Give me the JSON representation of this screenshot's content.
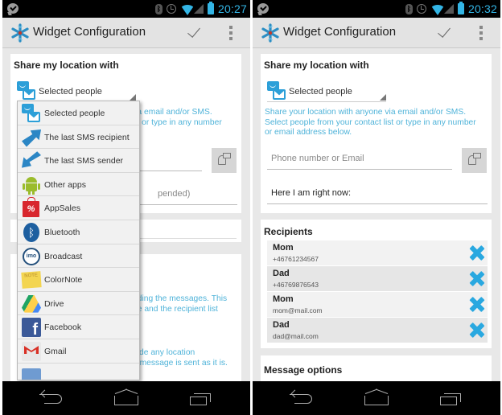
{
  "colors": {
    "accent": "#33b5e5",
    "help_text": "#4fb3d9",
    "remove_icon": "#29a8e0",
    "actionbar_bg": "#e3e3e3",
    "page_bg": "#e8e8e8"
  },
  "screens": [
    {
      "status_bar": {
        "notification_icon": "chat-bubble-check-icon",
        "icons": [
          "bluetooth-icon",
          "alarm-icon",
          "wifi-icon",
          "signal-icon",
          "battery-icon"
        ],
        "time": "20:27"
      },
      "action_bar": {
        "app_icon": "snowflake-app-icon",
        "title": "Widget Configuration",
        "confirm_icon": "check-icon",
        "overflow_icon": "overflow-menu-icon"
      },
      "share_card": {
        "title": "Share my location with",
        "spinner_value": "Selected people",
        "partial_help_text": [
          "via email and/or SMS.",
          "ist or type in any number"
        ],
        "partial_message_hint": "pended)"
      },
      "partial_card_2_text": [
        "nding the messages. This",
        "ge and the recipient list"
      ],
      "partial_card_3_text": [
        "lude any location",
        "e message is sent as it is."
      ],
      "dropdown": {
        "items": [
          {
            "label": "Selected people",
            "icon": "selected-people-icon"
          },
          {
            "label": "The last SMS recipient",
            "icon": "arrow-out-icon"
          },
          {
            "label": "The last SMS sender",
            "icon": "arrow-in-icon"
          },
          {
            "label": "Other apps",
            "icon": "android-icon"
          },
          {
            "label": "AppSales",
            "icon": "appsales-icon"
          },
          {
            "label": "Bluetooth",
            "icon": "bluetooth-icon"
          },
          {
            "label": "Broadcast",
            "icon": "imo-icon"
          },
          {
            "label": "ColorNote",
            "icon": "colornote-icon"
          },
          {
            "label": "Drive",
            "icon": "drive-icon"
          },
          {
            "label": "Facebook",
            "icon": "facebook-icon"
          },
          {
            "label": "Gmail",
            "icon": "gmail-icon"
          }
        ]
      },
      "nav_bar": {
        "back": "back-icon",
        "home": "home-icon",
        "recents": "recents-icon"
      }
    },
    {
      "status_bar": {
        "notification_icon": "chat-bubble-check-icon",
        "icons": [
          "bluetooth-icon",
          "alarm-icon",
          "wifi-icon",
          "signal-icon",
          "battery-icon"
        ],
        "time": "20:32"
      },
      "action_bar": {
        "app_icon": "snowflake-app-icon",
        "title": "Widget Configuration",
        "confirm_icon": "check-icon",
        "overflow_icon": "overflow-menu-icon"
      },
      "share_card": {
        "title": "Share my location with",
        "spinner_value": "Selected people",
        "help_text": [
          "Share your location with anyone via email and/or SMS.",
          "Select people from your contact list or type in any number",
          "or email address below."
        ],
        "recipient_input": {
          "placeholder": "Phone number or Email",
          "value": ""
        },
        "message_input": {
          "value": "Here I am right now:"
        }
      },
      "recipients_card": {
        "title": "Recipients",
        "items": [
          {
            "name": "Mom",
            "contact": "+46761234567"
          },
          {
            "name": "Dad",
            "contact": "+46769876543"
          },
          {
            "name": "Mom",
            "contact": "mom@mail.com"
          },
          {
            "name": "Dad",
            "contact": "dad@mail.com"
          }
        ]
      },
      "message_options_card": {
        "title": "Message options"
      },
      "nav_bar": {
        "back": "back-icon",
        "home": "home-icon",
        "recents": "recents-icon"
      }
    }
  ]
}
